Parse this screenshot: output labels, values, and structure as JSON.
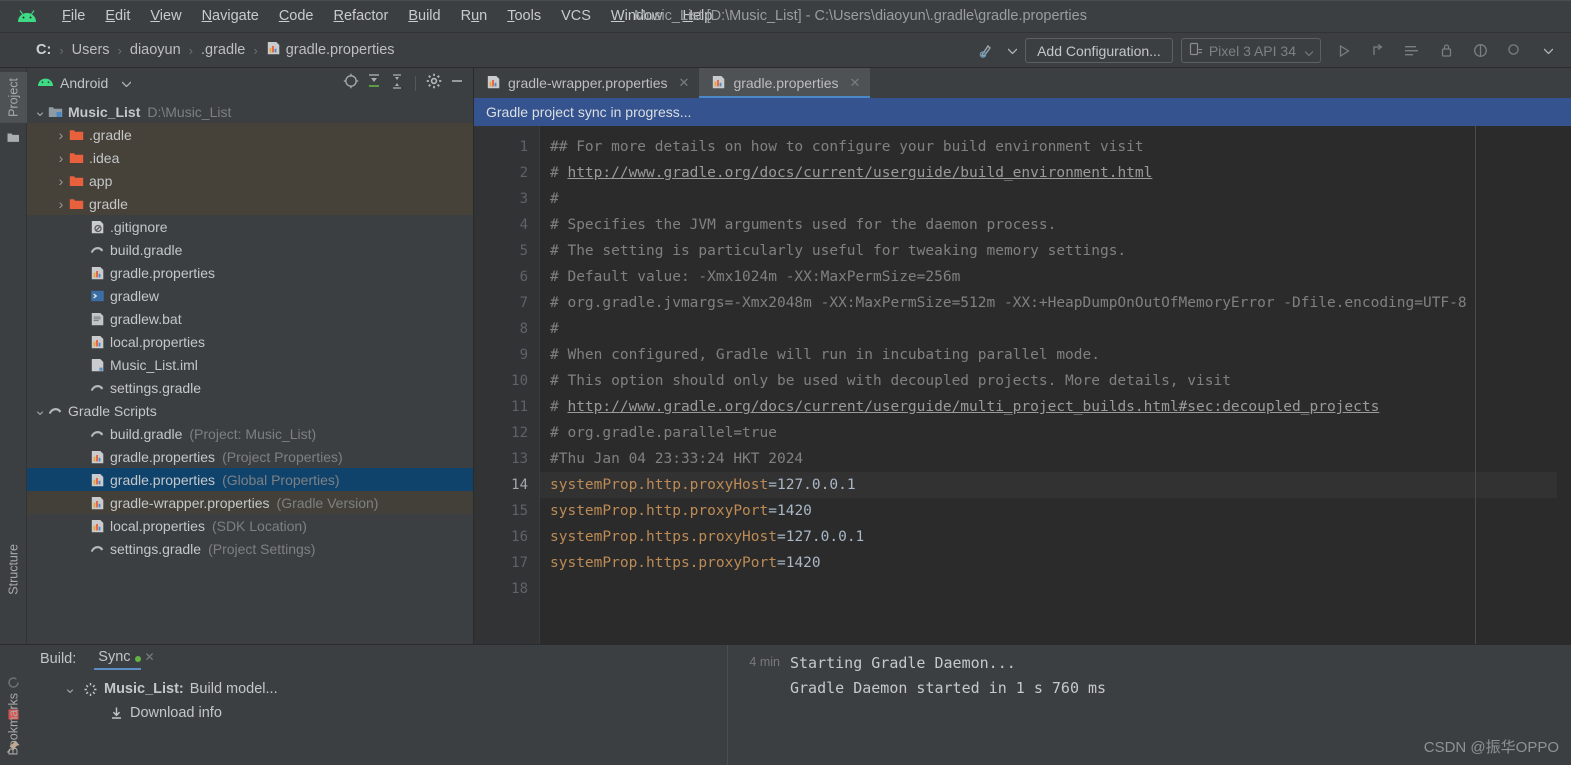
{
  "window": {
    "title": "Music_List [D:\\Music_List] - C:\\Users\\diaoyun\\.gradle\\gradle.properties"
  },
  "menubar": {
    "logo_icon": "android-logo-icon",
    "items": [
      {
        "label": "File",
        "mnemonic": "F"
      },
      {
        "label": "Edit",
        "mnemonic": "E"
      },
      {
        "label": "View",
        "mnemonic": "V"
      },
      {
        "label": "Navigate",
        "mnemonic": "N"
      },
      {
        "label": "Code",
        "mnemonic": "C"
      },
      {
        "label": "Refactor",
        "mnemonic": "R"
      },
      {
        "label": "Build",
        "mnemonic": "B"
      },
      {
        "label": "Run",
        "mnemonic": "u"
      },
      {
        "label": "Tools",
        "mnemonic": "T"
      },
      {
        "label": "VCS",
        "mnemonic": ""
      },
      {
        "label": "Window",
        "mnemonic": "W"
      },
      {
        "label": "Help",
        "mnemonic": "H"
      }
    ]
  },
  "breadcrumb": {
    "items": [
      "C:",
      "Users",
      "diaoyun",
      ".gradle",
      "gradle.properties"
    ],
    "separator": "›",
    "file_icon": "properties-file-icon"
  },
  "toolbar": {
    "sync_icon": "gradle-sync-icon",
    "sync_dropdown_icon": "chevron-down-icon",
    "add_configuration_label": "Add Configuration...",
    "device_icon": "device-icon",
    "device_label": "Pixel 3 API 34",
    "device_dropdown_icon": "chevron-down-icon",
    "run_icon": "run-icon",
    "debug_icon": "debug-icon",
    "profile_icon": "profile-icon",
    "lock_icon": "device-lock-icon",
    "sdk_icon": "sdk-manager-icon",
    "search_icon": "search-everywhere-icon",
    "more_icon": "chevron-down-icon"
  },
  "left_strip": {
    "items": [
      {
        "label": "Project",
        "icon": "project-icon",
        "active": true
      },
      {
        "label": "Structure",
        "icon": "structure-icon",
        "active": false
      },
      {
        "label": "Bookmarks",
        "icon": "bookmarks-icon",
        "active": false
      }
    ]
  },
  "project_panel": {
    "icon": "android-view-icon",
    "title": "Android",
    "dropdown_icon": "chevron-down-icon",
    "actions": [
      {
        "name": "select-opened-file-icon",
        "label": "Select Opened File"
      },
      {
        "name": "expand-all-icon",
        "label": "Expand All"
      },
      {
        "name": "collapse-all-icon",
        "label": "Collapse All"
      },
      {
        "name": "settings-gear-icon",
        "label": "Settings"
      },
      {
        "name": "hide-icon",
        "label": "Hide"
      }
    ],
    "tree": [
      {
        "label": "Music_List",
        "sub": "D:\\Music_List",
        "icon": "module-icon",
        "indent": 0,
        "arrow": "down",
        "bold": true,
        "state": "none"
      },
      {
        "label": ".gradle",
        "sub": "",
        "icon": "folder-icon",
        "indent": 1,
        "arrow": "right",
        "bold": false,
        "state": "hl"
      },
      {
        "label": ".idea",
        "sub": "",
        "icon": "folder-icon",
        "indent": 1,
        "arrow": "right",
        "bold": false,
        "state": "hl"
      },
      {
        "label": "app",
        "sub": "",
        "icon": "folder-icon",
        "indent": 1,
        "arrow": "right",
        "bold": false,
        "state": "hl"
      },
      {
        "label": "gradle",
        "sub": "",
        "icon": "folder-icon",
        "indent": 1,
        "arrow": "right",
        "bold": false,
        "state": "hl"
      },
      {
        "label": ".gitignore",
        "sub": "",
        "icon": "gitignore-icon",
        "indent": 2,
        "arrow": "none",
        "bold": false,
        "state": "none"
      },
      {
        "label": "build.gradle",
        "sub": "",
        "icon": "gradle-icon",
        "indent": 2,
        "arrow": "none",
        "bold": false,
        "state": "none"
      },
      {
        "label": "gradle.properties",
        "sub": "",
        "icon": "properties-file-icon",
        "indent": 2,
        "arrow": "none",
        "bold": false,
        "state": "none"
      },
      {
        "label": "gradlew",
        "sub": "",
        "icon": "script-icon",
        "indent": 2,
        "arrow": "none",
        "bold": false,
        "state": "none"
      },
      {
        "label": "gradlew.bat",
        "sub": "",
        "icon": "bat-file-icon",
        "indent": 2,
        "arrow": "none",
        "bold": false,
        "state": "none"
      },
      {
        "label": "local.properties",
        "sub": "",
        "icon": "properties-file-icon",
        "indent": 2,
        "arrow": "none",
        "bold": false,
        "state": "none"
      },
      {
        "label": "Music_List.iml",
        "sub": "",
        "icon": "iml-file-icon",
        "indent": 2,
        "arrow": "none",
        "bold": false,
        "state": "none"
      },
      {
        "label": "settings.gradle",
        "sub": "",
        "icon": "gradle-icon",
        "indent": 2,
        "arrow": "none",
        "bold": false,
        "state": "none"
      },
      {
        "label": "Gradle Scripts",
        "sub": "",
        "icon": "gradle-icon",
        "indent": 0,
        "arrow": "down",
        "bold": false,
        "state": "none"
      },
      {
        "label": "build.gradle",
        "sub": "(Project: Music_List)",
        "icon": "gradle-icon",
        "indent": 2,
        "arrow": "none",
        "bold": false,
        "state": "none"
      },
      {
        "label": "gradle.properties",
        "sub": "(Project Properties)",
        "icon": "properties-file-icon",
        "indent": 2,
        "arrow": "none",
        "bold": false,
        "state": "none"
      },
      {
        "label": "gradle.properties",
        "sub": "(Global Properties)",
        "icon": "properties-file-icon",
        "indent": 2,
        "arrow": "none",
        "bold": false,
        "state": "sel"
      },
      {
        "label": "gradle-wrapper.properties",
        "sub": "(Gradle Version)",
        "icon": "properties-file-icon",
        "indent": 2,
        "arrow": "none",
        "bold": false,
        "state": "hlsoft"
      },
      {
        "label": "local.properties",
        "sub": "(SDK Location)",
        "icon": "properties-file-icon",
        "indent": 2,
        "arrow": "none",
        "bold": false,
        "state": "none"
      },
      {
        "label": "settings.gradle",
        "sub": "(Project Settings)",
        "icon": "gradle-icon",
        "indent": 2,
        "arrow": "none",
        "bold": false,
        "state": "none"
      }
    ]
  },
  "editor": {
    "tabs": [
      {
        "label": "gradle-wrapper.properties",
        "icon": "properties-file-icon",
        "active": false,
        "close_icon": "close-icon"
      },
      {
        "label": "gradle.properties",
        "icon": "properties-file-icon",
        "active": true,
        "close_icon": "close-icon"
      }
    ],
    "notification": "Gradle project sync in progress...",
    "line_numbers": [
      1,
      2,
      3,
      4,
      5,
      6,
      7,
      8,
      9,
      10,
      11,
      12,
      13,
      14,
      15,
      16,
      17,
      18
    ],
    "current_line": 14,
    "lines": [
      {
        "n": 1,
        "type": "comment",
        "text": "## For more details on how to configure your build environment visit"
      },
      {
        "n": 2,
        "type": "comment-link",
        "prefix": "# ",
        "link": "http://www.gradle.org/docs/current/userguide/build_environment.html"
      },
      {
        "n": 3,
        "type": "comment",
        "text": "#"
      },
      {
        "n": 4,
        "type": "comment",
        "text": "# Specifies the JVM arguments used for the daemon process."
      },
      {
        "n": 5,
        "type": "comment",
        "text": "# The setting is particularly useful for tweaking memory settings."
      },
      {
        "n": 6,
        "type": "comment",
        "text": "# Default value: -Xmx1024m -XX:MaxPermSize=256m"
      },
      {
        "n": 7,
        "type": "comment",
        "text": "# org.gradle.jvmargs=-Xmx2048m -XX:MaxPermSize=512m -XX:+HeapDumpOnOutOfMemoryError -Dfile.encoding=UTF-8"
      },
      {
        "n": 8,
        "type": "comment",
        "text": "#"
      },
      {
        "n": 9,
        "type": "comment",
        "text": "# When configured, Gradle will run in incubating parallel mode."
      },
      {
        "n": 10,
        "type": "comment",
        "text": "# This option should only be used with decoupled projects. More details, visit"
      },
      {
        "n": 11,
        "type": "comment-link",
        "prefix": "# ",
        "link": "http://www.gradle.org/docs/current/userguide/multi_project_builds.html#sec:decoupled_projects"
      },
      {
        "n": 12,
        "type": "comment",
        "text": "# org.gradle.parallel=true"
      },
      {
        "n": 13,
        "type": "comment",
        "text": "#Thu Jan 04 23:33:24 HKT 2024"
      },
      {
        "n": 14,
        "type": "property",
        "key": "systemProp.http.proxyHost",
        "value": "127.0.0.1"
      },
      {
        "n": 15,
        "type": "property",
        "key": "systemProp.http.proxyPort",
        "value": "1420"
      },
      {
        "n": 16,
        "type": "property",
        "key": "systemProp.https.proxyHost",
        "value": "127.0.0.1"
      },
      {
        "n": 17,
        "type": "property",
        "key": "systemProp.https.proxyPort",
        "value": "1420"
      },
      {
        "n": 18,
        "type": "empty",
        "text": ""
      }
    ]
  },
  "build_panel": {
    "label": "Build:",
    "tab_label": "Sync",
    "tab_close_icon": "close-icon",
    "status_dot_color": "#62b543",
    "side_icons": [
      {
        "name": "build-tool-icon"
      },
      {
        "name": "restart-icon"
      },
      {
        "name": "stop-icon"
      },
      {
        "name": "pin-icon"
      }
    ],
    "tree": [
      {
        "arrow": "down",
        "icon": "spinner-icon",
        "bold_label": "Music_List:",
        "label": " Build model...",
        "indent": 0
      },
      {
        "arrow": "none",
        "icon": "download-icon",
        "bold_label": "",
        "label": "Download info",
        "indent": 1
      }
    ],
    "console": {
      "time": "4 min",
      "lines": [
        "Starting Gradle Daemon...",
        "Gradle Daemon started in 1 s 760 ms"
      ]
    }
  },
  "watermark": "CSDN @振华OPPO",
  "colors": {
    "accent_blue": "#4a88c7",
    "selection_blue": "#10436b",
    "banner_blue": "#35538f",
    "panel_bg": "#3c3f41",
    "editor_bg": "#2b2b2b",
    "gutter_bg": "#313335",
    "folder_orange": "#e8603c",
    "property_key_orange": "#bd8b55",
    "comment_gray": "#808080",
    "green": "#62b543"
  }
}
